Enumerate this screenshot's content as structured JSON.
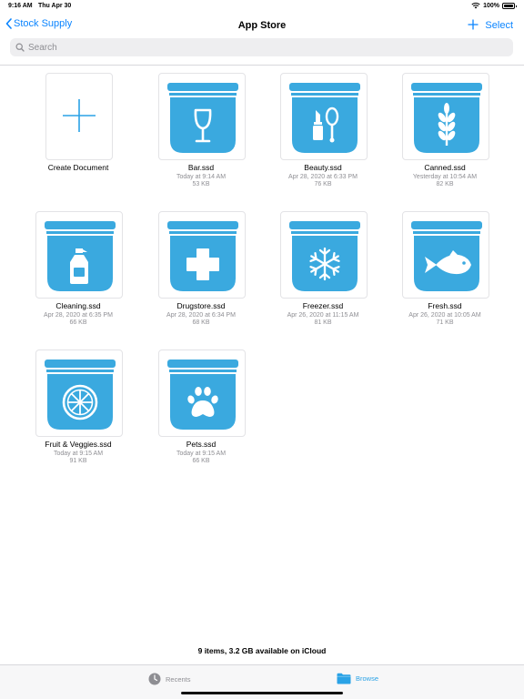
{
  "status_bar": {
    "time": "9:16 AM",
    "date": "Thu Apr 30",
    "battery": "100%"
  },
  "nav": {
    "back_label": "Stock Supply",
    "title": "App Store",
    "select_label": "Select"
  },
  "search": {
    "placeholder": "Search"
  },
  "create": {
    "label": "Create Document"
  },
  "files": [
    {
      "name": "Bar.ssd",
      "date": "Today at 9:14 AM",
      "size": "53 KB",
      "icon": "wine-glass-icon"
    },
    {
      "name": "Beauty.ssd",
      "date": "Apr 28, 2020 at 6:33 PM",
      "size": "76 KB",
      "icon": "lipstick-mirror-icon"
    },
    {
      "name": "Canned.ssd",
      "date": "Yesterday at 10:54 AM",
      "size": "82 KB",
      "icon": "wheat-icon"
    },
    {
      "name": "Cleaning.ssd",
      "date": "Apr 28, 2020 at 6:35 PM",
      "size": "66 KB",
      "icon": "detergent-bottle-icon"
    },
    {
      "name": "Drugstore.ssd",
      "date": "Apr 28, 2020 at 6:34 PM",
      "size": "68 KB",
      "icon": "medical-cross-icon"
    },
    {
      "name": "Freezer.ssd",
      "date": "Apr 26, 2020 at 11:15 AM",
      "size": "81 KB",
      "icon": "snowflake-icon"
    },
    {
      "name": "Fresh.ssd",
      "date": "Apr 26, 2020 at 10:05 AM",
      "size": "71 KB",
      "icon": "fish-icon"
    },
    {
      "name": "Fruit & Veggies.ssd",
      "date": "Today at 9:15 AM",
      "size": "91 KB",
      "icon": "citrus-slice-icon"
    },
    {
      "name": "Pets.ssd",
      "date": "Today at 9:15 AM",
      "size": "66 KB",
      "icon": "paw-print-icon"
    }
  ],
  "footer": {
    "info": "9 items, 3.2 GB available on iCloud"
  },
  "tabs": [
    {
      "label": "Recents",
      "active": false,
      "icon": "clock-icon"
    },
    {
      "label": "Browse",
      "active": true,
      "icon": "folder-icon"
    }
  ],
  "colors": {
    "accent": "#0a84ff",
    "brand_blue": "#3aa9df",
    "tab_active": "#2aa2e6"
  }
}
